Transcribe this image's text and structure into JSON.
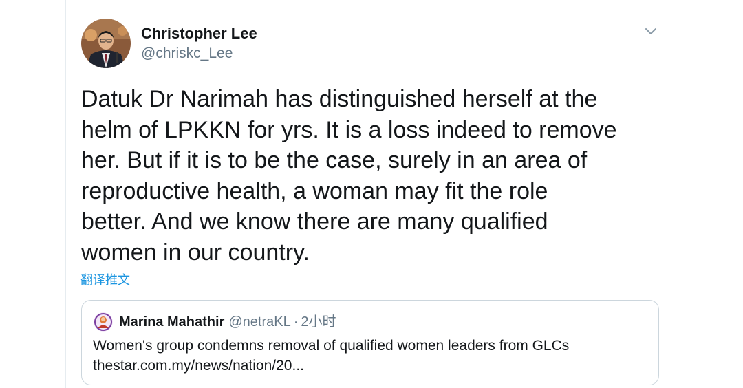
{
  "tweet": {
    "author_name": "Christopher Lee",
    "author_handle": "@chriskc_Lee",
    "text": "Datuk Dr Narimah has distinguished herself at the\nhelm of LPKKN for yrs. It is a loss indeed to remove\nher. But if it is to be the case, surely in an area of\nreproductive health, a woman may fit the role\nbetter. And we know there are many qualified\nwomen in our country.",
    "translate_label": "翻译推文",
    "menu_icon": "chevron-down-icon"
  },
  "quoted_tweet": {
    "author_name": "Marina Mahathir",
    "author_handle": "@netraKL",
    "separator": "·",
    "time": "2小时",
    "headline": "Women's group condemns removal of qualified women leaders from GLCs",
    "link": "thestar.com.my/news/nation/20..."
  },
  "colors": {
    "link_blue": "#1b95e0",
    "text_primary": "#14171a",
    "text_secondary": "#657786",
    "border": "#ccd6dd"
  }
}
